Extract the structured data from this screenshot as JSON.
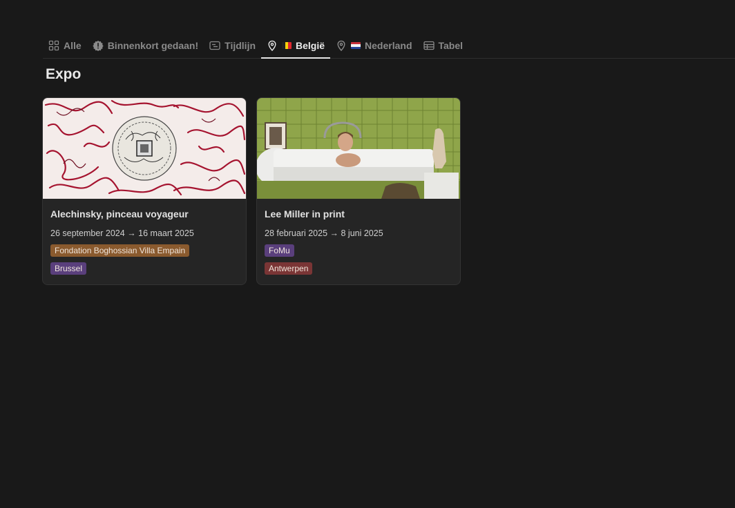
{
  "tabs": [
    {
      "label": "Alle",
      "icon": "grid-icon"
    },
    {
      "label": "Binnenkort gedaan!",
      "icon": "alert-badge-icon"
    },
    {
      "label": "Tijdlijn",
      "icon": "timeline-icon"
    },
    {
      "label": "België",
      "icon": "map-pin-icon",
      "flag": "be-flag-icon",
      "active": true
    },
    {
      "label": "Nederland",
      "icon": "map-pin-icon",
      "flag": "nl-flag-icon"
    },
    {
      "label": "Tabel",
      "icon": "table-icon"
    }
  ],
  "group_title": "Expo",
  "cards": [
    {
      "title": "Alechinsky, pinceau voyageur",
      "date": "26 september 2024 → 16 maart 2025",
      "venue": "Fondation Boghossian Villa Empain",
      "venue_color": "#8a5a2e",
      "city": "Brussel",
      "city_color": "#5a3f7c",
      "cover": "red-ink-artwork-image"
    },
    {
      "title": "Lee Miller in print",
      "date": "28 februari 2025 → 8 juni 2025",
      "venue": "FoMu",
      "venue_color": "#5a3f7c",
      "city": "Antwerpen",
      "city_color": "#7a3535",
      "cover": "bathtub-photo-image"
    }
  ],
  "colors": {
    "background": "#191919",
    "card": "#252525",
    "active_tab": "#ececec"
  }
}
